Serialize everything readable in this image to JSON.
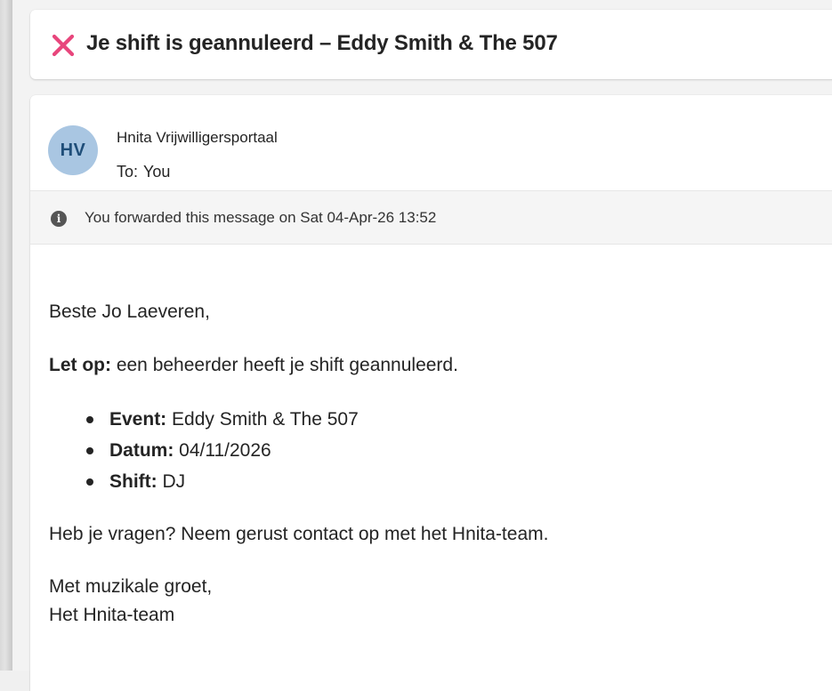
{
  "subject": {
    "icon": "cross-mark-icon",
    "icon_color": "#e8467c",
    "text": "Je shift is geannuleerd – Eddy Smith & The 507"
  },
  "message": {
    "avatar_initials": "HV",
    "avatar_color": "#a9c6e2",
    "sender_name": "Hnita Vrijwilligersportaal",
    "to_label": "To:",
    "to_value": "You"
  },
  "info_bar": {
    "icon": "info-icon",
    "text": "You forwarded this message on Sat 04-Apr-26 13:52"
  },
  "body": {
    "greeting": "Beste Jo Laeveren,",
    "notice_label": "Let op:",
    "notice_text": " een beheerder heeft je shift geannuleerd.",
    "details": [
      {
        "label": "Event:",
        "value": " Eddy Smith & The 507"
      },
      {
        "label": "Datum:",
        "value": " 04/11/2026"
      },
      {
        "label": "Shift:",
        "value": " DJ"
      }
    ],
    "question": "Heb je vragen? Neem gerust contact op met het Hnita-team.",
    "closing_line1": "Met muzikale groet,",
    "closing_line2": "Het Hnita-team"
  }
}
